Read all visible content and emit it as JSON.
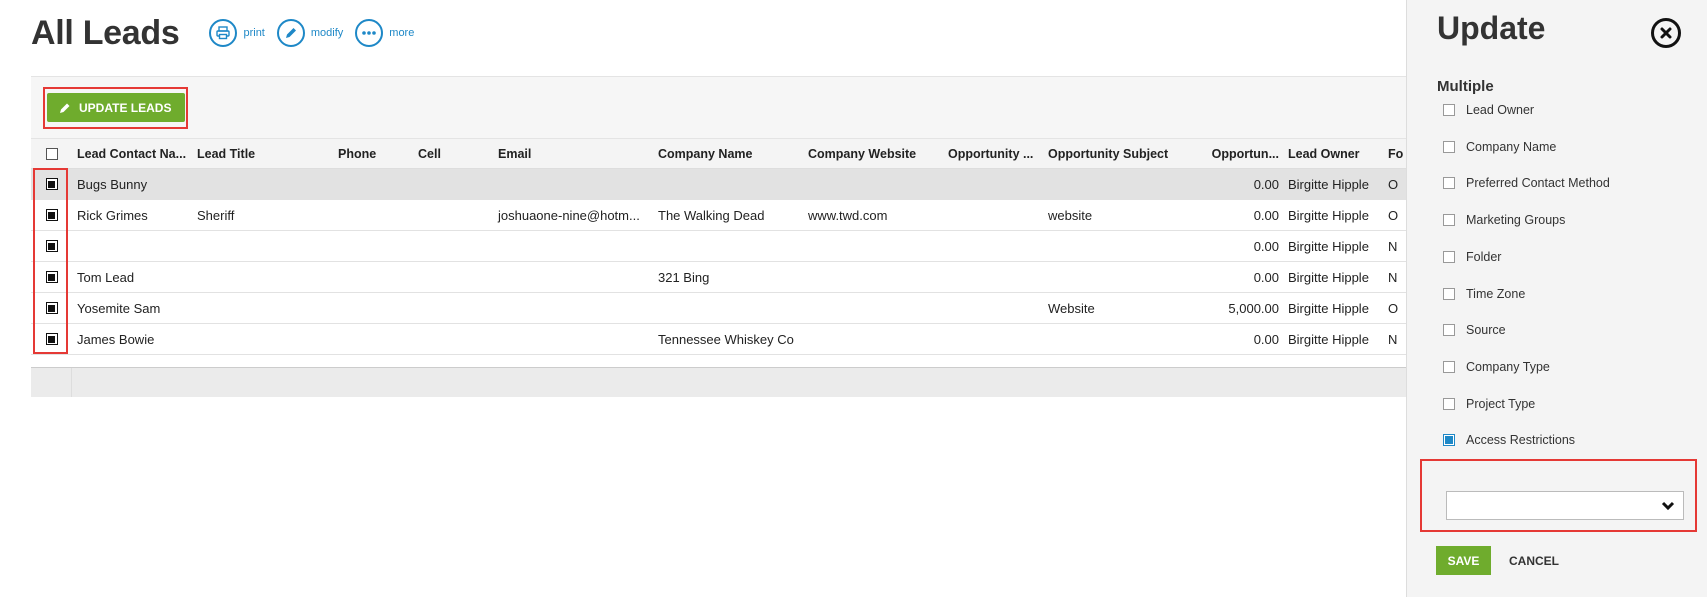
{
  "header": {
    "title": "All Leads",
    "actions": [
      {
        "label": "print",
        "icon": "print-icon"
      },
      {
        "label": "modify",
        "icon": "pencil-icon"
      },
      {
        "label": "more",
        "icon": "more-icon"
      }
    ]
  },
  "toolbar": {
    "update_label": "UPDATE LEADS"
  },
  "table": {
    "columns": [
      "Lead Contact Na...",
      "Lead Title",
      "Phone",
      "Cell",
      "Email",
      "Company Name",
      "Company Website",
      "Opportunity ...",
      "Opportunity Subject",
      "Opportun...",
      "Lead Owner",
      "Fo"
    ],
    "rows": [
      {
        "checked": true,
        "selected": true,
        "cells": [
          "Bugs Bunny",
          "",
          "",
          "",
          "",
          "",
          "",
          "",
          "",
          "0.00",
          "Birgitte Hipple",
          "O"
        ]
      },
      {
        "checked": true,
        "selected": false,
        "cells": [
          "Rick Grimes",
          "Sheriff",
          "",
          "",
          "joshuaone-nine@hotm...",
          "The Walking Dead",
          "www.twd.com",
          "",
          "website",
          "0.00",
          "Birgitte Hipple",
          "O"
        ]
      },
      {
        "checked": true,
        "selected": false,
        "cells": [
          "",
          "",
          "",
          "",
          "",
          "",
          "",
          "",
          "",
          "0.00",
          "Birgitte Hipple",
          "N"
        ]
      },
      {
        "checked": true,
        "selected": false,
        "cells": [
          "Tom Lead",
          "",
          "",
          "",
          "",
          "321 Bing",
          "",
          "",
          "",
          "0.00",
          "Birgitte Hipple",
          "N"
        ]
      },
      {
        "checked": true,
        "selected": false,
        "cells": [
          "Yosemite Sam",
          "",
          "",
          "",
          "",
          "",
          "",
          "",
          "Website",
          "5,000.00",
          "Birgitte Hipple",
          "O"
        ]
      },
      {
        "checked": true,
        "selected": false,
        "cells": [
          "James Bowie",
          "",
          "",
          "",
          "",
          "Tennessee Whiskey Co",
          "",
          "",
          "",
          "0.00",
          "Birgitte Hipple",
          "N"
        ]
      }
    ]
  },
  "panel": {
    "title": "Update",
    "subtitle": "Multiple",
    "options": [
      {
        "label": "Lead Owner",
        "checked": false
      },
      {
        "label": "Company Name",
        "checked": false
      },
      {
        "label": "Preferred Contact Method",
        "checked": false
      },
      {
        "label": "Marketing Groups",
        "checked": false
      },
      {
        "label": "Folder",
        "checked": false
      },
      {
        "label": "Time Zone",
        "checked": false
      },
      {
        "label": "Source",
        "checked": false
      },
      {
        "label": "Company Type",
        "checked": false
      },
      {
        "label": "Project Type",
        "checked": false
      },
      {
        "label": "Access Restrictions",
        "checked": true
      }
    ],
    "select_value": "",
    "save_label": "SAVE",
    "cancel_label": "CANCEL"
  },
  "colors": {
    "accent_blue": "#1e88c7",
    "green": "#6fac2d",
    "highlight_red": "#e53935"
  }
}
